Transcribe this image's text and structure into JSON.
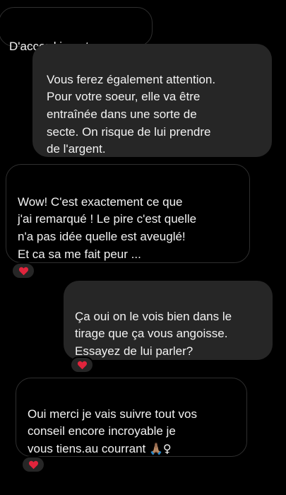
{
  "conversation": {
    "messages": [
      {
        "side": "received",
        "text": "D'accord je note sa."
      },
      {
        "side": "sent",
        "text": "Vous ferez également attention.\nPour votre soeur, elle va être\nentraînée dans une sorte de\nsecte. On risque de lui prendre\nde l'argent."
      },
      {
        "side": "received",
        "text": "Wow! C'est exactement ce que\nj'ai remarqué ! Le pire c'est quelle\nn'a pas idée quelle est aveuglé!\nEt ca sa me fait peur ...",
        "reaction": "heart-icon"
      },
      {
        "side": "sent",
        "text": "Ça oui on le vois bien dans le\ntirage que ça vous angoisse.\nEssayez de lui parler?",
        "reaction": "heart-icon"
      },
      {
        "side": "received",
        "text": "Oui merci je vais suivre tout vos\nconseil encore incroyable  je\nvous tiens.au courrant ",
        "emoji": "🙏🏽♀",
        "reaction": "heart-icon"
      }
    ],
    "reaction_color": "#e0243c"
  }
}
